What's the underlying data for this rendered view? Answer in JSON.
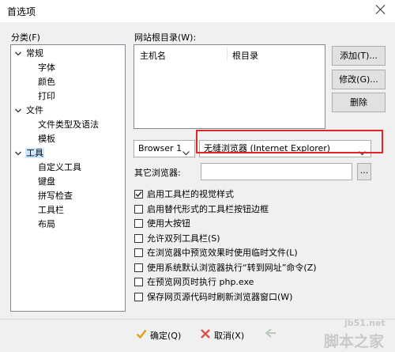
{
  "window": {
    "title": "首选项"
  },
  "category": {
    "label": "分类(F)",
    "items": [
      {
        "label": "常规",
        "level": 0,
        "expanded": true
      },
      {
        "label": "字体",
        "level": 1
      },
      {
        "label": "颜色",
        "level": 1
      },
      {
        "label": "打印",
        "level": 1
      },
      {
        "label": "文件",
        "level": 0,
        "expanded": true
      },
      {
        "label": "文件类型及语法",
        "level": 1
      },
      {
        "label": "模板",
        "level": 1
      },
      {
        "label": "工具",
        "level": 0,
        "expanded": true,
        "selected": true
      },
      {
        "label": "自定义工具",
        "level": 1
      },
      {
        "label": "键盘",
        "level": 1
      },
      {
        "label": "拼写检查",
        "level": 1
      },
      {
        "label": "工具栏",
        "level": 1
      },
      {
        "label": "布局",
        "level": 1
      }
    ]
  },
  "webroot": {
    "label": "网站根目录(W):",
    "columns": [
      "主机名",
      "根目录"
    ],
    "buttons": {
      "add": "添加(T)...",
      "edit": "修改(G)...",
      "delete": "删除"
    }
  },
  "browser": {
    "selector_value": "Browser 1",
    "browser_value": "无缝浏览器 (Internet Explorer)",
    "other_label": "其它浏览器:",
    "other_value": "",
    "browse_label": "..."
  },
  "options": [
    {
      "label": "启用工具栏的视觉样式",
      "checked": true
    },
    {
      "label": "启用替代形式的工具栏按钮边框",
      "checked": false
    },
    {
      "label": "使用大按钮",
      "checked": false
    },
    {
      "label": "允许双列工具栏(S)",
      "checked": false
    },
    {
      "label": "在浏览器中预览效果时使用临时文件(L)",
      "checked": false
    },
    {
      "label": "使用系统默认浏览器执行“转到网址”命令(Z)",
      "checked": false
    },
    {
      "label": "在预览网页时执行 php.exe",
      "checked": false
    },
    {
      "label": "保存网页源代码时刷新浏览器窗口(W)",
      "checked": false
    }
  ],
  "footer": {
    "ok": "确定(Q)",
    "cancel": "取消(X)"
  },
  "watermark": {
    "site": "jb51.net",
    "brand": "脚本之家"
  },
  "colors": {
    "highlight": "#e0262b",
    "selection": "#cce8ff",
    "ok_check": "#e0a020",
    "cancel_x": "#d9534f"
  }
}
